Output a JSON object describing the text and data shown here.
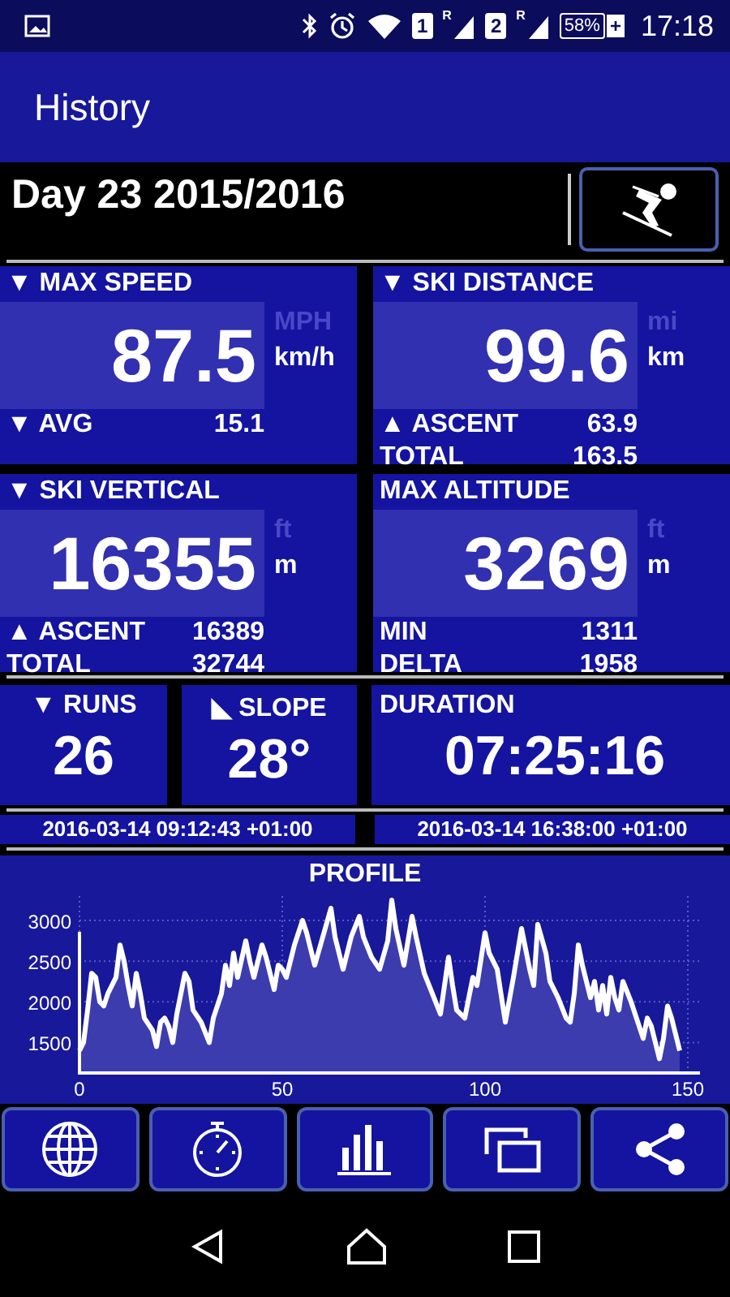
{
  "status_bar": {
    "sims": [
      {
        "label": "1",
        "roaming": "R"
      },
      {
        "label": "2",
        "roaming": "R"
      }
    ],
    "battery": "58%",
    "charging": "+",
    "time": "17:18"
  },
  "app_bar": {
    "title": "History"
  },
  "day_header": {
    "title": "Day 23 2015/2016"
  },
  "panels": [
    {
      "title": "▼ MAX SPEED",
      "value": "87.5",
      "units": [
        {
          "label": "MPH",
          "selected": false
        },
        {
          "label": "km/h",
          "selected": true
        }
      ],
      "rows": [
        {
          "label": "▼ AVG",
          "value": "15.1"
        }
      ]
    },
    {
      "title": "▼ SKI DISTANCE",
      "value": "99.6",
      "units": [
        {
          "label": "mi",
          "selected": false
        },
        {
          "label": "km",
          "selected": true
        }
      ],
      "rows": [
        {
          "label": "▲ ASCENT",
          "value": "63.9"
        },
        {
          "label": "TOTAL",
          "value": "163.5"
        }
      ]
    },
    {
      "title": "▼ SKI VERTICAL",
      "value": "16355",
      "units": [
        {
          "label": "ft",
          "selected": false
        },
        {
          "label": "m",
          "selected": true
        }
      ],
      "rows": [
        {
          "label": "▲ ASCENT",
          "value": "16389"
        },
        {
          "label": "TOTAL",
          "value": "32744"
        }
      ]
    },
    {
      "title": "MAX ALTITUDE",
      "value": "3269",
      "units": [
        {
          "label": "ft",
          "selected": false
        },
        {
          "label": "m",
          "selected": true
        }
      ],
      "rows": [
        {
          "label": "MIN",
          "value": "1311"
        },
        {
          "label": "DELTA",
          "value": "1958"
        }
      ]
    }
  ],
  "small_panels": [
    {
      "title": "▼ RUNS",
      "value": "26"
    },
    {
      "title": "◣ SLOPE",
      "value": "28°"
    },
    {
      "title": "DURATION",
      "value": "07:25:16"
    }
  ],
  "timestamps": [
    "2016-03-14 09:12:43 +01:00",
    "2016-03-14 16:38:00 +01:00"
  ],
  "profile": {
    "title": "PROFILE",
    "chart_data": {
      "type": "area",
      "grid": true,
      "xlim": [
        0,
        153
      ],
      "ylim": [
        1125,
        3300
      ],
      "xticks": [
        0,
        50,
        100,
        150
      ],
      "yticks": [
        1500,
        2000,
        2500,
        3000
      ],
      "x": [
        0,
        1,
        2,
        3,
        4,
        5,
        6,
        7,
        9,
        10,
        11,
        12,
        13,
        14,
        15,
        16,
        18,
        19,
        20,
        21,
        22,
        23,
        24,
        26,
        27,
        28,
        30,
        32,
        33,
        35,
        36,
        37,
        38,
        39,
        41,
        42,
        43,
        45,
        46,
        48,
        49,
        50,
        51,
        53,
        55,
        56,
        58,
        60,
        62,
        63,
        65,
        67,
        69,
        70,
        72,
        74,
        76,
        77,
        78,
        80,
        82,
        83,
        85,
        87,
        89,
        91,
        92,
        93,
        95,
        97,
        98,
        100,
        101,
        103,
        105,
        107,
        109,
        111,
        112,
        113,
        115,
        116,
        118,
        120,
        121,
        122,
        123,
        124,
        126,
        127,
        128,
        129,
        130,
        131,
        132,
        133,
        134,
        136,
        138,
        139,
        140,
        141,
        143,
        144,
        145,
        146,
        148
      ],
      "series": [
        {
          "color": "#ffffff",
          "values": [
            1400,
            1500,
            1900,
            2350,
            2300,
            2000,
            1950,
            2100,
            2300,
            2700,
            2500,
            2200,
            1950,
            2350,
            2100,
            1800,
            1650,
            1450,
            1750,
            1800,
            1700,
            1500,
            1850,
            2350,
            2250,
            1900,
            1750,
            1500,
            1800,
            2100,
            2450,
            2200,
            2600,
            2300,
            2750,
            2500,
            2300,
            2700,
            2550,
            2150,
            2450,
            2400,
            2300,
            2700,
            3000,
            2850,
            2450,
            2800,
            3150,
            2800,
            2400,
            2800,
            3050,
            2800,
            2550,
            2400,
            2750,
            3250,
            2900,
            2450,
            3050,
            2800,
            2350,
            2100,
            1850,
            2550,
            2200,
            1900,
            1800,
            2300,
            2200,
            2850,
            2600,
            2400,
            1750,
            2300,
            2900,
            2400,
            2200,
            2950,
            2600,
            2250,
            2050,
            1800,
            1750,
            2100,
            2700,
            2450,
            2050,
            2250,
            1900,
            2200,
            1850,
            2300,
            2050,
            1900,
            2250,
            2000,
            1700,
            1550,
            1800,
            1700,
            1300,
            1550,
            1950,
            1800,
            1400
          ]
        }
      ]
    }
  },
  "toolbar": [
    {
      "kind": "globe"
    },
    {
      "kind": "stopwatch"
    },
    {
      "kind": "bars"
    },
    {
      "kind": "windows"
    },
    {
      "kind": "share"
    }
  ]
}
